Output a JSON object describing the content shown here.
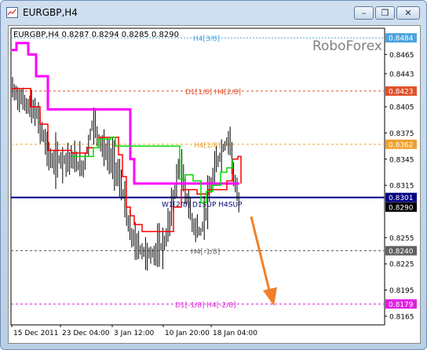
{
  "window": {
    "title": "EURGBP,H4",
    "buttons": {
      "minimize": "–",
      "restore": "❐",
      "close": "✕"
    }
  },
  "chart_header": "EURGBP,H4  0.8287 0.8294 0.8285 0.8290",
  "watermark": "RoboForex",
  "chart_data": {
    "type": "line",
    "y_ticks": [
      "0.8465",
      "0.8443",
      "0.8405",
      "0.8375",
      "0.8345",
      "0.8315",
      "0.8285",
      "0.8255",
      "0.8225",
      "0.8195",
      "0.8165"
    ],
    "x_ticks": [
      "15 Dec 2011",
      "23 Dec 04:00",
      "3 Jan 12:00",
      "10 Jan 20:00",
      "18 Jan 04:00"
    ],
    "ylim": [
      0.8155,
      0.8495
    ],
    "levels": [
      {
        "label": "H4[3/8]",
        "price": "0.8484",
        "value": 0.8484,
        "color": "#4aa3e0",
        "style": "dotted"
      },
      {
        "label": "D1[1/8] H4[2/8]",
        "price": "0.8423",
        "value": 0.8423,
        "color": "#e0502a",
        "style": "dashed"
      },
      {
        "label": "H4[1/8]",
        "price": "0.8362",
        "value": 0.8362,
        "color": "#f0a030",
        "style": "dashed"
      },
      {
        "label": "W1[2/8] D1SUP H4SUP",
        "price": "0.8301",
        "value": 0.8301,
        "color": "#000080",
        "style": "solid"
      },
      {
        "label": "H4[-1/8]",
        "price": "0.8240",
        "value": 0.824,
        "color": "#606060",
        "style": "dashed"
      },
      {
        "label": "D1[-1/8] H4[-2/8]",
        "price": "0.8179",
        "value": 0.8179,
        "color": "#e020e0",
        "style": "dashed"
      }
    ],
    "current_price": {
      "price": "0.8290",
      "value": 0.829
    },
    "colors": {
      "price_bars": "#000000",
      "fast_line": "#00dd00",
      "mid_line": "#ff0000",
      "slow_line": "#ff00ff",
      "arrow": "#f0802a"
    }
  }
}
